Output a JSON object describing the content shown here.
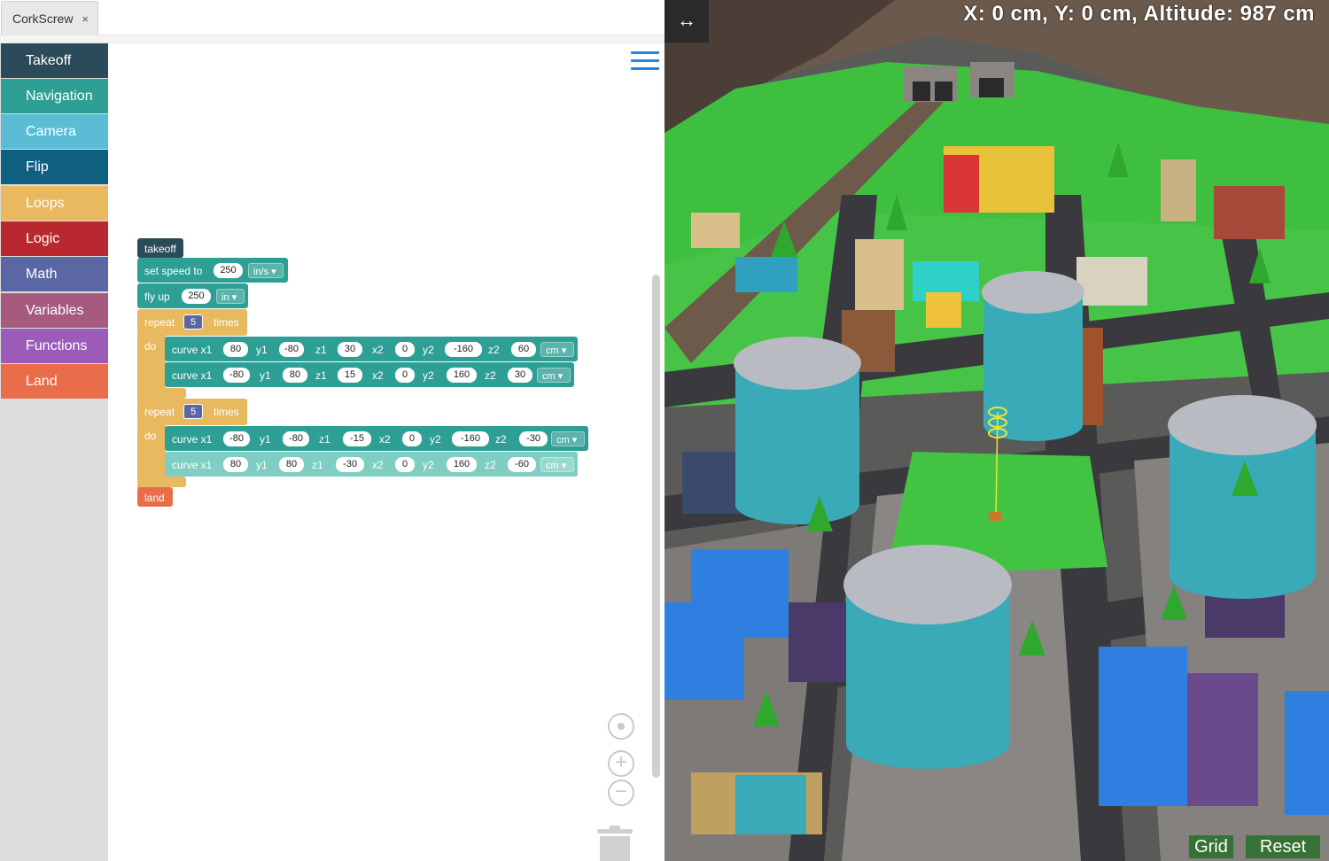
{
  "tab": {
    "title": "CorkScrew",
    "close_glyph": "×"
  },
  "toolbox": {
    "categories": [
      {
        "label": "Takeoff",
        "color": "#2c4b5a"
      },
      {
        "label": "Navigation",
        "color": "#2e9f94"
      },
      {
        "label": "Camera",
        "color": "#5bbcd6"
      },
      {
        "label": "Flip",
        "color": "#0e5f80"
      },
      {
        "label": "Loops",
        "color": "#e8b95e"
      },
      {
        "label": "Logic",
        "color": "#b8282e"
      },
      {
        "label": "Math",
        "color": "#5b67a5"
      },
      {
        "label": "Variables",
        "color": "#a65a7e"
      },
      {
        "label": "Functions",
        "color": "#9a5cb8"
      },
      {
        "label": "Land",
        "color": "#e96d4b"
      }
    ]
  },
  "program": {
    "takeoff": "takeoff",
    "set_speed": {
      "label": "set speed to",
      "value": "250",
      "unit": "in/s"
    },
    "fly_up": {
      "label": "fly up",
      "value": "250",
      "unit": "in"
    },
    "repeat1": {
      "label": "repeat",
      "count": "5",
      "times": "times",
      "do": "do",
      "curves": [
        {
          "x1": "80",
          "y1": "-80",
          "z1": "30",
          "x2": "0",
          "y2": "-160",
          "z2": "60",
          "unit": "cm"
        },
        {
          "x1": "-80",
          "y1": "80",
          "z1": "15",
          "x2": "0",
          "y2": "160",
          "z2": "30",
          "unit": "cm"
        }
      ]
    },
    "repeat2": {
      "label": "repeat",
      "count": "5",
      "times": "times",
      "do": "do",
      "curves": [
        {
          "x1": "-80",
          "y1": "-80",
          "z1": "-15",
          "x2": "0",
          "y2": "-160",
          "z2": "-30",
          "unit": "cm"
        },
        {
          "x1": "80",
          "y1": "80",
          "z1": "-30",
          "x2": "0",
          "y2": "160",
          "z2": "-60",
          "unit": "cm"
        }
      ]
    },
    "land": "land",
    "curve_labels": {
      "x1": "curve x1",
      "y1": "y1",
      "z1": "z1",
      "x2": "x2",
      "y2": "y2",
      "z2": "z2"
    }
  },
  "viewer": {
    "coords": "X: 0 cm, Y: 0 cm, Altitude: 987 cm",
    "expand_glyph": "↔",
    "grid_label": "Grid",
    "reset_label": "Reset"
  }
}
